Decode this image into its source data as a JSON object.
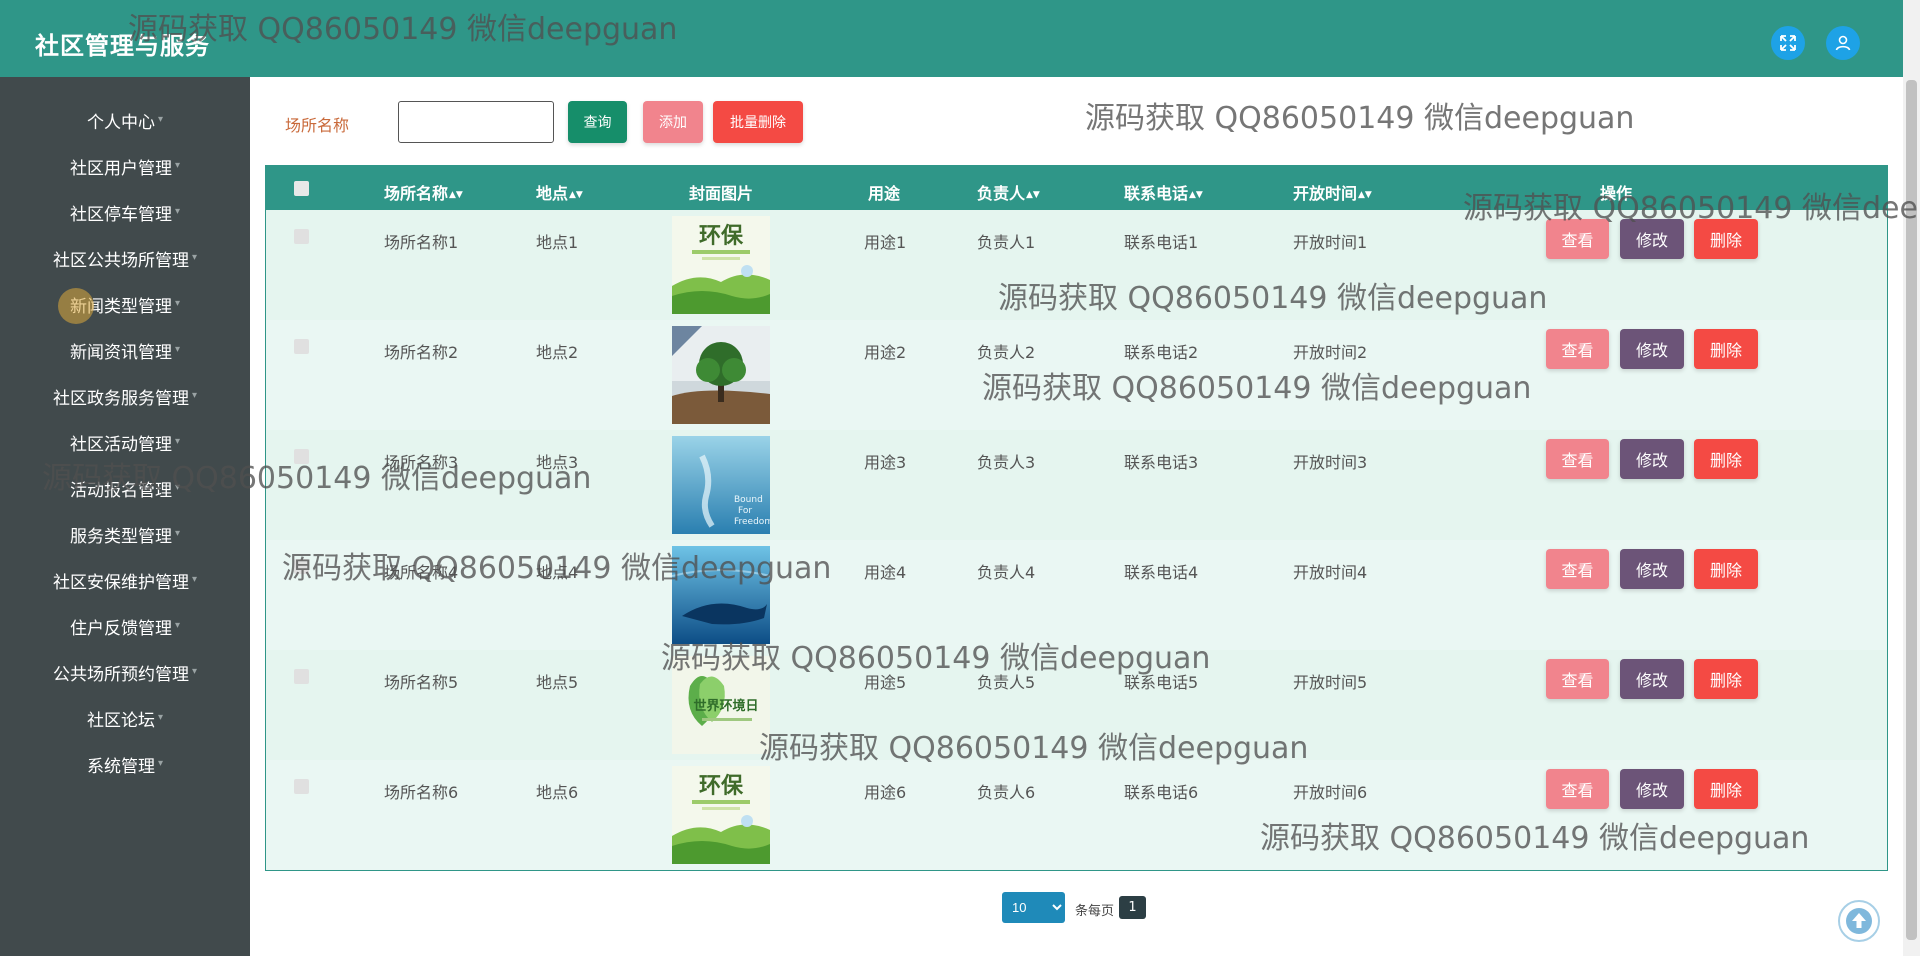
{
  "header": {
    "title": "社区管理与服务",
    "fullscreen_icon": "expand-icon",
    "user_icon": "user-icon"
  },
  "sidebar": {
    "items": [
      {
        "label": "个人中心"
      },
      {
        "label": "社区用户管理"
      },
      {
        "label": "社区停车管理"
      },
      {
        "label": "社区公共场所管理"
      },
      {
        "label": "新闻类型管理"
      },
      {
        "label": "新闻资讯管理"
      },
      {
        "label": "社区政务服务管理"
      },
      {
        "label": "社区活动管理"
      },
      {
        "label": "活动报名管理"
      },
      {
        "label": "服务类型管理"
      },
      {
        "label": "社区安保维护管理"
      },
      {
        "label": "住户反馈管理"
      },
      {
        "label": "公共场所预约管理"
      },
      {
        "label": "社区论坛"
      },
      {
        "label": "系统管理"
      }
    ]
  },
  "search": {
    "label": "场所名称",
    "value": "",
    "query_label": "查询",
    "add_label": "添加",
    "batch_delete_label": "批量删除"
  },
  "table": {
    "columns": [
      "场所名称",
      "地点",
      "封面图片",
      "用途",
      "负责人",
      "联系电话",
      "开放时间",
      "操作"
    ],
    "rows": [
      {
        "name": "场所名称1",
        "location": "地点1",
        "image": "environment-poster",
        "usage": "用途1",
        "manager": "负责人1",
        "phone": "联系电话1",
        "open_time": "开放时间1"
      },
      {
        "name": "场所名称2",
        "location": "地点2",
        "image": "tree-landscape",
        "usage": "用途2",
        "manager": "负责人2",
        "phone": "联系电话2",
        "open_time": "开放时间2"
      },
      {
        "name": "场所名称3",
        "location": "地点3",
        "image": "bound-for-freedom",
        "usage": "用途3",
        "manager": "负责人3",
        "phone": "联系电话3",
        "open_time": "开放时间3"
      },
      {
        "name": "场所名称4",
        "location": "地点4",
        "image": "ocean-whale",
        "usage": "用途4",
        "manager": "负责人4",
        "phone": "联系电话4",
        "open_time": "开放时间4"
      },
      {
        "name": "场所名称5",
        "location": "地点5",
        "image": "world-environment-day",
        "usage": "用途5",
        "manager": "负责人5",
        "phone": "联系电话5",
        "open_time": "开放时间5"
      },
      {
        "name": "场所名称6",
        "location": "地点6",
        "image": "environment-poster",
        "usage": "用途6",
        "manager": "负责人6",
        "phone": "联系电话6",
        "open_time": "开放时间6"
      }
    ],
    "actions": {
      "view": "查看",
      "edit": "修改",
      "delete": "删除"
    }
  },
  "thumbs": {
    "env_title": "环保",
    "bound_text": "Bound For Freedom",
    "world_text": "世界环境日"
  },
  "pagination": {
    "page_size": "10",
    "per_page_label": "条每页",
    "current_page": "1"
  },
  "watermark": "源码获取 QQ86050149 微信deepguan",
  "colors": {
    "primary": "#2f9688",
    "sidebar": "#414a4c",
    "view": "#f1848d",
    "edit": "#6c5478",
    "delete": "#f44a44"
  }
}
